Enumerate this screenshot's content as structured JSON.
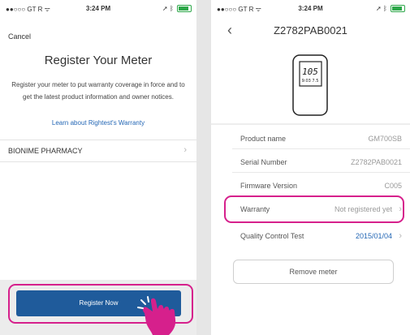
{
  "left_screen": {
    "status": {
      "carrier": "●●○○○ GT R ᯤ",
      "time": "3:24 PM"
    },
    "cancel": "Cancel",
    "title": "Register Your Meter",
    "description": "Register your meter to put warranty coverage in force and to get the latest product information and owner notices.",
    "warranty_link": "Learn about Rightest's Warranty",
    "pharmacy": "BIONIME PHARMACY",
    "register_button": "Register Now"
  },
  "right_screen": {
    "status": {
      "carrier": "●●○○○ GT R ᯤ",
      "time": "3:24 PM"
    },
    "title": "Z2782PAB0021",
    "meter_display": {
      "reading": "105",
      "small": "9:03  7.5"
    },
    "details": [
      {
        "label": "Product name",
        "value": "GM700SB"
      },
      {
        "label": "Serial Number",
        "value": "Z2782PAB0021"
      },
      {
        "label": "Firmware Version",
        "value": "C005"
      },
      {
        "label": "Warranty",
        "value": "Not registered yet"
      },
      {
        "label": "Quality Control Test",
        "value": "2015/01/04"
      }
    ],
    "remove_button": "Remove meter"
  },
  "colors": {
    "primary_button": "#1f5b9b",
    "link": "#2467b5",
    "highlight": "#d6208c",
    "battery": "#2ea84a"
  },
  "icons": [
    "wifi-icon",
    "bluetooth-icon",
    "battery-icon",
    "chevron-right-icon",
    "back-chevron-icon",
    "hand-pointer-icon",
    "meter-device-icon"
  ]
}
